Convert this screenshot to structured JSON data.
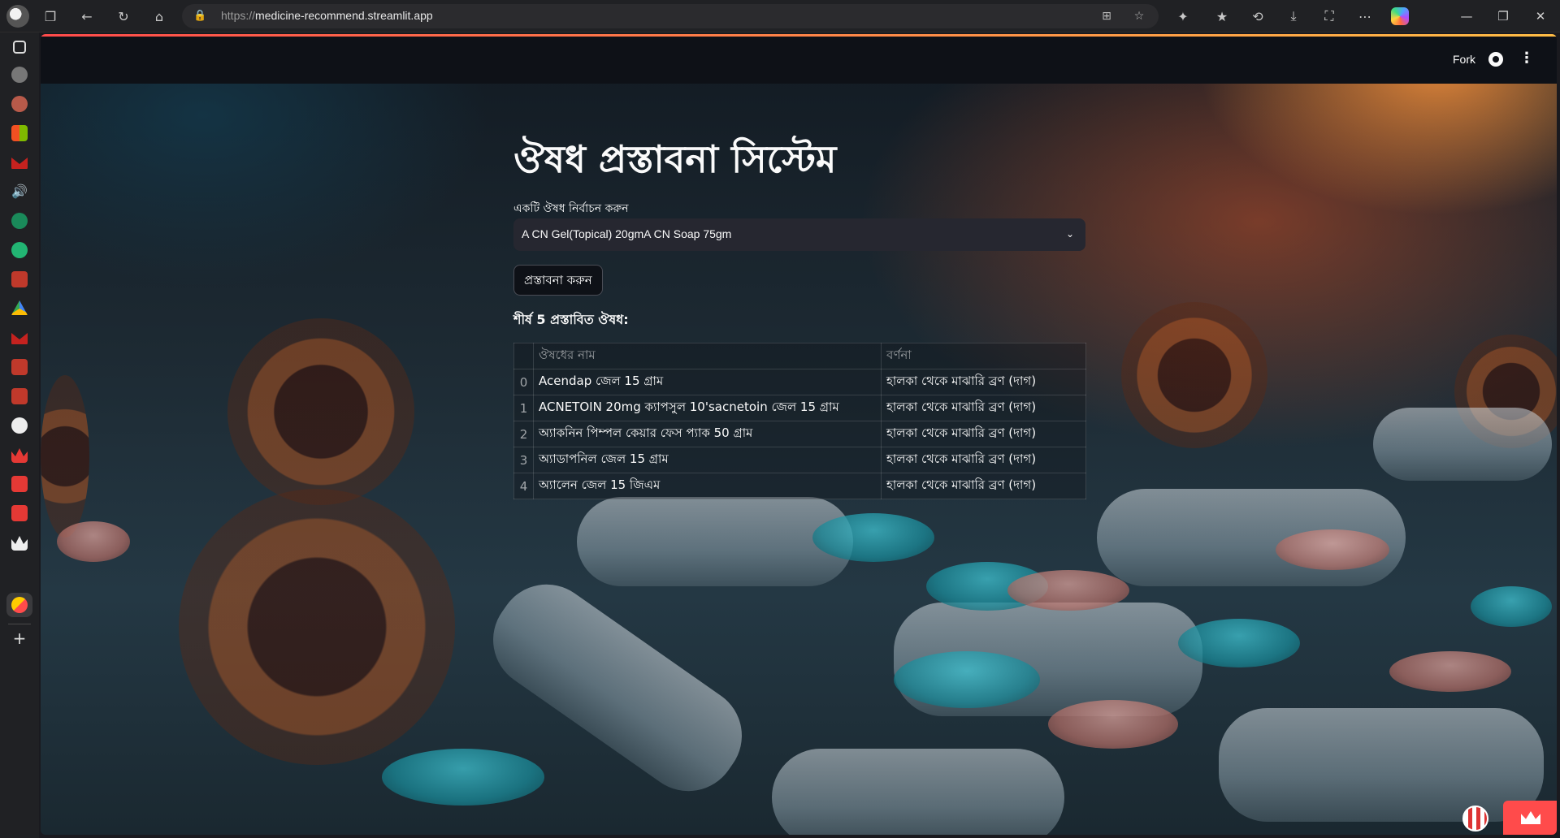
{
  "browser": {
    "url_scheme": "https://",
    "url_host": "medicine-recommend.streamlit.app",
    "copilot_icon": "copilot-icon"
  },
  "sidebar_icons": [
    "tabs-icon",
    "chrome-icon",
    "avatar-icon",
    "apps-grid-icon",
    "gmail-icon",
    "speaker-icon",
    "green-app-icon",
    "green-app-icon",
    "red-app-icon",
    "drive-icon",
    "gmail-icon",
    "red-app-icon",
    "red-app-icon",
    "openai-icon",
    "crown-icon",
    "crown-icon",
    "crown-icon",
    "crown-icon",
    "streamlit-tab-icon",
    "add-icon"
  ],
  "header": {
    "fork_label": "Fork"
  },
  "main": {
    "title": "ঔষধ প্রস্তাবনা সিস্টেম",
    "select_label": "একটি ঔষধ নির্বাচন করুন",
    "select_value": "A CN Gel(Topical) 20gmA CN Soap 75gm",
    "button_label": "প্রস্তাবনা করুন",
    "results_heading": "শীর্ষ 5 প্রস্তাবিত ঔষধ:",
    "table": {
      "columns": [
        "",
        "ঔষধের নাম",
        "বর্ণনা"
      ],
      "rows": [
        {
          "index": "0",
          "name": "Acendap জেল 15 গ্রাম",
          "description": "হালকা থেকে মাঝারি ব্রণ (দাগ)"
        },
        {
          "index": "1",
          "name": "ACNETOIN 20mg ক্যাপসুল 10'sacnetoin জেল 15 গ্রাম",
          "description": "হালকা থেকে মাঝারি ব্রণ (দাগ)"
        },
        {
          "index": "2",
          "name": "অ্যাকনিন পিম্পল কেয়ার ফেস প্যাক 50 গ্রাম",
          "description": "হালকা থেকে মাঝারি ব্রণ (দাগ)"
        },
        {
          "index": "3",
          "name": "অ্যাডাপনিল জেল 15 গ্রাম",
          "description": "হালকা থেকে মাঝারি ব্রণ (দাগ)"
        },
        {
          "index": "4",
          "name": "অ্যালেন জেল 15 জিএম",
          "description": "হালকা থেকে মাঝারি ব্রণ (দাগ)"
        }
      ]
    }
  },
  "colors": {
    "accent": "#ff4b4b",
    "app_header_bg": "#0e1117",
    "select_bg": "#262730",
    "text": "#fafafa"
  }
}
